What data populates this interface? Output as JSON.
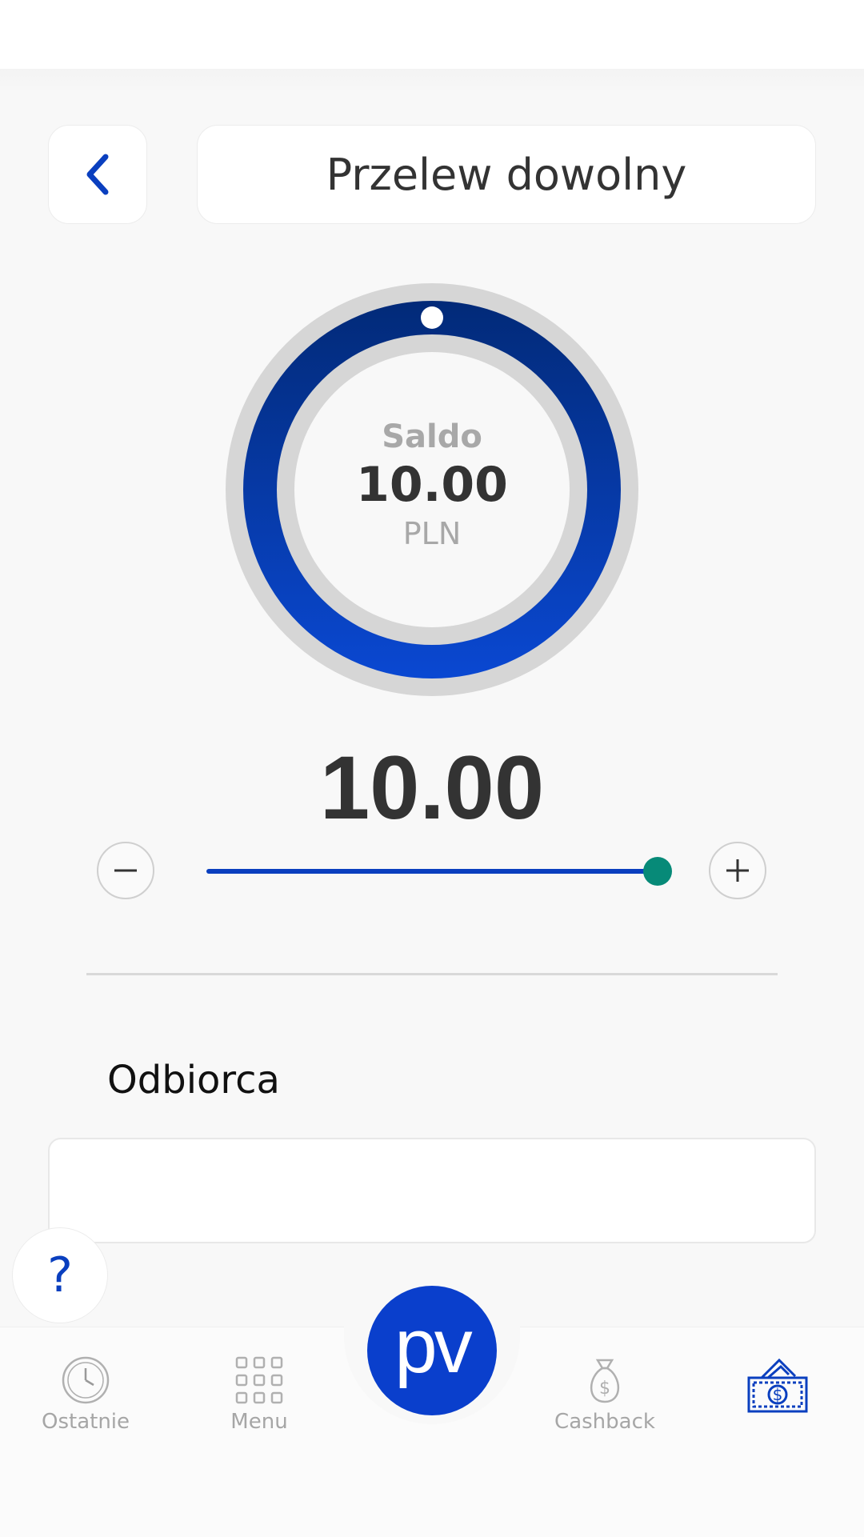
{
  "header": {
    "title": "Przelew dowolny",
    "back_icon": "chevron-left-icon"
  },
  "balance": {
    "label": "Saldo",
    "value": "10.00",
    "currency": "PLN",
    "ring_fill_fraction": 1.0
  },
  "amount": {
    "value": "10.00",
    "slider_fraction": 1.0
  },
  "recipient": {
    "label": "Odbiorca",
    "value": ""
  },
  "help": {
    "label": "?"
  },
  "bottom_nav": {
    "items": [
      {
        "label": "Ostatnie",
        "icon": "clock-icon"
      },
      {
        "label": "Menu",
        "icon": "grid-icon"
      },
      {
        "label": "Cashback",
        "icon": "money-bag-icon"
      },
      {
        "label": "",
        "icon": "cash-transfer-icon",
        "active": true
      }
    ],
    "center_button": {
      "label": "pv"
    }
  },
  "colors": {
    "accent": "#0a3fcc",
    "ring_dark": "#022a78",
    "ring_light": "#0a48d2",
    "slider_thumb": "#078a78",
    "muted_text": "#a8a8a8"
  }
}
